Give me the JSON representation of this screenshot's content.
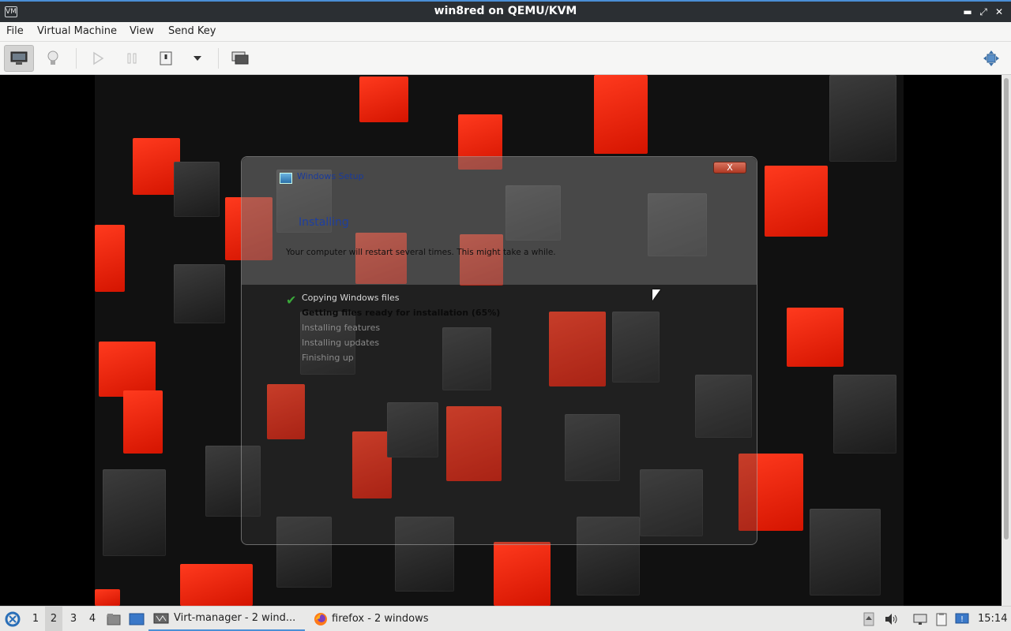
{
  "window": {
    "title": "win8red on QEMU/KVM",
    "app_icon_label": "VM"
  },
  "menu": {
    "items": [
      "File",
      "Virtual Machine",
      "View",
      "Send Key"
    ]
  },
  "setup": {
    "window_title": "Windows Setup",
    "close_label": "X",
    "heading": "Installing",
    "subtitle": "Your computer will restart several times. This might take a while.",
    "check_symbol": "✔",
    "steps": [
      {
        "label": "Copying Windows files",
        "state": "done"
      },
      {
        "label": "Getting files ready for installation (65%)",
        "state": "current"
      },
      {
        "label": "Installing features",
        "state": "pending"
      },
      {
        "label": "Installing updates",
        "state": "pending"
      },
      {
        "label": "Finishing up",
        "state": "pending"
      }
    ]
  },
  "taskbar": {
    "workspaces": [
      "1",
      "2",
      "3",
      "4"
    ],
    "active_workspace": "2",
    "tasks": [
      {
        "label": "Virt-manager - 2 wind...",
        "icon": "virt-manager-icon"
      },
      {
        "label": "firefox - 2 windows",
        "icon": "firefox-icon"
      }
    ],
    "clock": "15:14"
  },
  "colors": {
    "accent": "#4a8fd6",
    "cube_red": "#ff2b12",
    "check_green": "#3aa83a"
  }
}
